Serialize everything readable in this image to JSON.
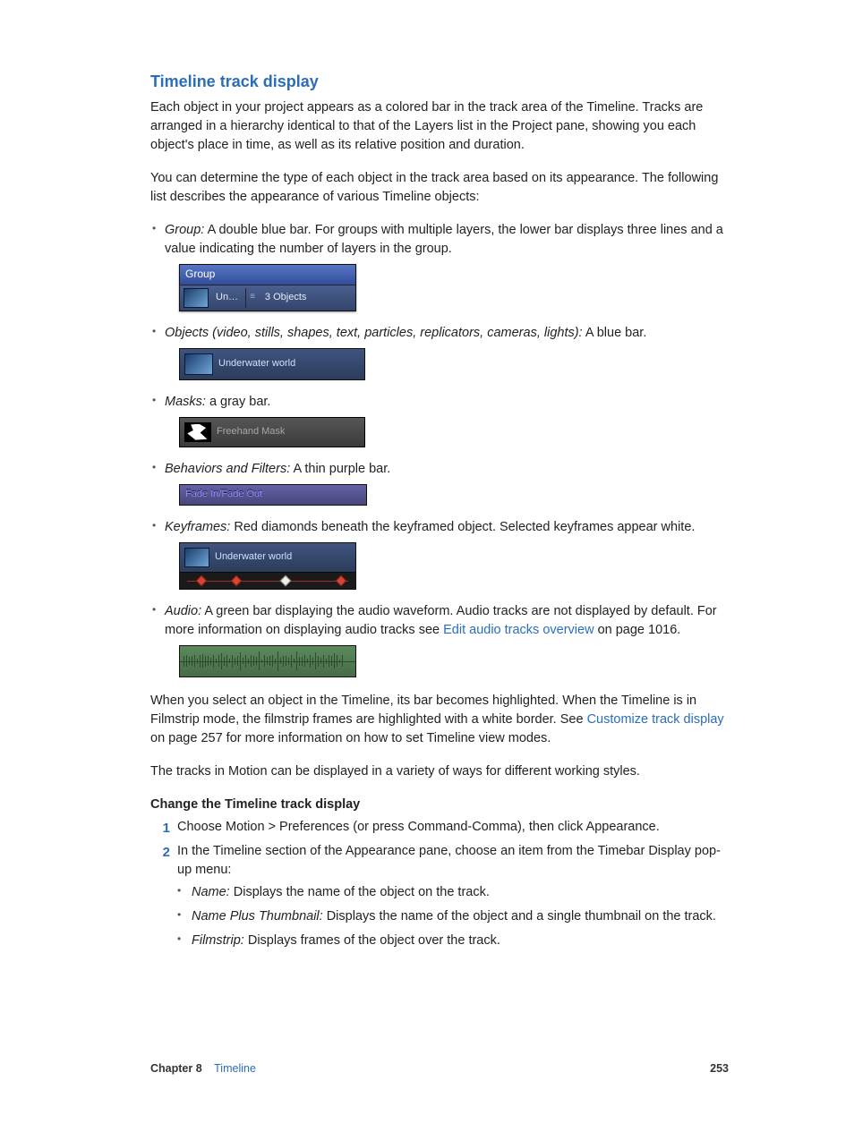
{
  "heading": "Timeline track display",
  "intro1": "Each object in your project appears as a colored bar in the track area of the Timeline. Tracks are arranged in a hierarchy identical to that of the Layers list in the Project pane, showing you each object's place in time, as well as its relative position and duration.",
  "intro2": "You can determine the type of each object in the track area based on its appearance. The following list describes the appearance of various Timeline objects:",
  "items": {
    "group": {
      "term": "Group:",
      "desc": " A double blue bar. For groups with multiple layers, the lower bar displays three lines and a value indicating the number of layers in the group.",
      "fig": {
        "title": "Group",
        "cell1": "Un…",
        "cell2": "3 Objects"
      }
    },
    "objects": {
      "term": "Objects (video, stills, shapes, text, particles, replicators, cameras, lights):",
      "desc": " A blue bar.",
      "fig": {
        "label": "Underwater world"
      }
    },
    "masks": {
      "term": "Masks:",
      "desc": " a gray bar.",
      "fig": {
        "label": "Freehand Mask"
      }
    },
    "behaviors": {
      "term": "Behaviors and Filters:",
      "desc": " A thin purple bar.",
      "fig": {
        "label": "Fade In/Fade Out"
      }
    },
    "keyframes": {
      "term": "Keyframes:",
      "desc": " Red diamonds beneath the keyframed object. Selected keyframes appear white.",
      "fig": {
        "label": "Underwater world"
      }
    },
    "audio": {
      "term": "Audio:",
      "desc_a": " A green bar displaying the audio waveform. Audio tracks are not displayed by default. For more information on displaying audio tracks see ",
      "link": "Edit audio tracks overview",
      "desc_b": " on page 1016."
    }
  },
  "post1_a": "When you select an object in the Timeline, its bar becomes highlighted. When the Timeline is in Filmstrip mode, the filmstrip frames are highlighted with a white border. See ",
  "post1_link": "Customize track display",
  "post1_b": " on page 257 for more information on how to set Timeline view modes.",
  "post2": "The tracks in Motion can be displayed in a variety of ways for different working styles.",
  "change_heading": "Change the Timeline track display",
  "steps": {
    "s1": "Choose Motion > Preferences (or press Command-Comma), then click Appearance.",
    "s2": "In the Timeline section of the Appearance pane, choose an item from the Timebar Display pop-up menu:",
    "opts": {
      "name": {
        "term": "Name:",
        "desc": " Displays the name of the object on the track."
      },
      "npt": {
        "term": "Name Plus Thumbnail:",
        "desc": " Displays the name of the object and a single thumbnail on the track."
      },
      "filmstrip": {
        "term": "Filmstrip:",
        "desc": " Displays frames of the object over the track."
      }
    }
  },
  "footer": {
    "chapter": "Chapter 8",
    "section": "Timeline",
    "page": "253"
  }
}
